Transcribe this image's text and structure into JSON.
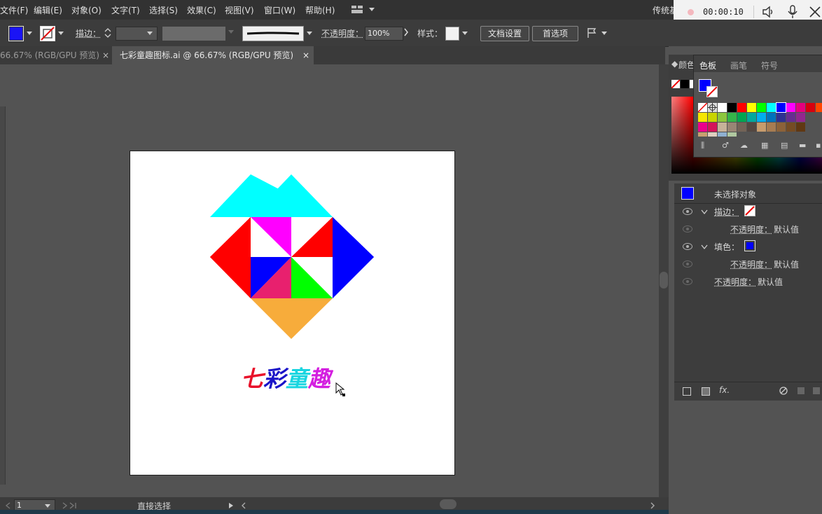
{
  "menu": [
    "文件(F)",
    "编辑(E)",
    "对象(O)",
    "文字(T)",
    "选择(S)",
    "效果(C)",
    "视图(V)",
    "窗口(W)",
    "帮助(H)"
  ],
  "workspace_label": "传统基",
  "recorder": {
    "time": "00:00:10"
  },
  "control": {
    "stroke_label": "描边：",
    "opacity_label": "不透明度：",
    "opacity_value": "100%",
    "style_label": "样式：",
    "doc_settings": "文档设置",
    "preferences": "首选项",
    "fill_color": "#1a14f5"
  },
  "tabs": [
    {
      "label": "66.67% (RGB/GPU 预览)",
      "close": "×",
      "active": false
    },
    {
      "label": "七彩童趣图标.ai @ 66.67% (RGB/GPU 预览)",
      "close": "×",
      "active": true
    }
  ],
  "artwork": {
    "title_chars": [
      "七",
      "彩",
      "童",
      "趣"
    ],
    "title_colors": [
      "#e8112a",
      "#1a14c8",
      "#19d5e0",
      "#d41ee0"
    ],
    "colors": {
      "top": "#00ffff",
      "left": "#ff0000",
      "right": "#0000ff",
      "bottom": "#f7ac3b",
      "magenta": "#ff00ff",
      "red_inner": "#ff0000",
      "blue_inner": "#0000ff",
      "pink": "#e8206e",
      "green": "#00ff00",
      "white": "#ffffff"
    }
  },
  "status": {
    "page": "1",
    "tool": "直接选择"
  },
  "panel_color": {
    "tabs": [
      "颜色",
      "色板",
      "画笔",
      "符号"
    ],
    "active_tab": "色板"
  },
  "swatches": {
    "row1": [
      "#ffffff",
      "#000000",
      "#ff0000",
      "#ffff00",
      "#00ff00",
      "#00ffff",
      "#0000ff",
      "#ff00ff",
      "#e6007e",
      "#d7000f",
      "#ff4500"
    ],
    "row2": [
      "#f5e600",
      "#c8d400",
      "#8cc63e",
      "#35b44a",
      "#00a651",
      "#00a99d",
      "#00aeef",
      "#0072bc",
      "#2e3192",
      "#662d91",
      "#92278f"
    ],
    "row3": [
      "#ec008c",
      "#d4145a",
      "#c7b299",
      "#998675",
      "#736357",
      "#534741",
      "#c69c6d",
      "#a67c52",
      "#8c6239",
      "#754c24",
      "#603813"
    ]
  },
  "appearance": {
    "no_selection": "未选择对象",
    "stroke_label": "描边：",
    "fill_label": "填色：",
    "opacity_label": "不透明度：",
    "default_value": "默认值",
    "fill_color": "#0000ff"
  }
}
